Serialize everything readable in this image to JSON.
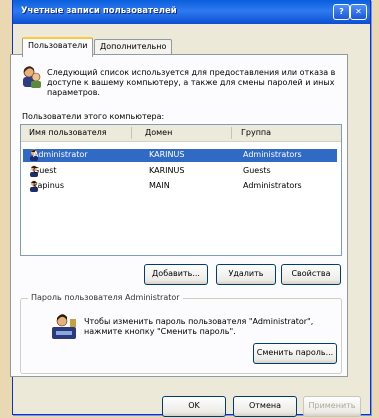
{
  "window": {
    "title": "Учетные записи пользователей",
    "help_btn": "?",
    "close_btn": "✕"
  },
  "tabs": [
    {
      "label": "Пользователи",
      "active": true
    },
    {
      "label": "Дополнительно",
      "active": false
    }
  ],
  "intro_text": "Следующий список используется для предоставления или отказа в доступе к вашему компьютеру, а также для смены паролей и иных параметров.",
  "users_section_label": "Пользователи этого компьютера:",
  "table": {
    "columns": [
      "Имя пользователя",
      "Домен",
      "Группа"
    ],
    "rows": [
      {
        "name": "Administrator",
        "domain": "KARINUS",
        "group": "Administrators",
        "selected": true
      },
      {
        "name": "Guest",
        "domain": "KARINUS",
        "group": "Guests",
        "selected": false
      },
      {
        "name": "kapinus",
        "domain": "MAIN",
        "group": "Administrators",
        "selected": false
      }
    ]
  },
  "buttons": {
    "add": "Добавить...",
    "remove": "Удалить",
    "properties": "Свойства"
  },
  "password_group": {
    "title": "Пароль пользователя Administrator",
    "text": "Чтобы изменить пароль пользователя \"Administrator\", нажмите кнопку \"Сменить пароль\".",
    "change_button": "Сменить пароль..."
  },
  "footer": {
    "ok": "OK",
    "cancel": "Отмена",
    "apply": "Применить"
  },
  "colors": {
    "title_bar": "#0a5fdc",
    "selection": "#316ac5",
    "dialog_bg": "#ece9d8"
  }
}
